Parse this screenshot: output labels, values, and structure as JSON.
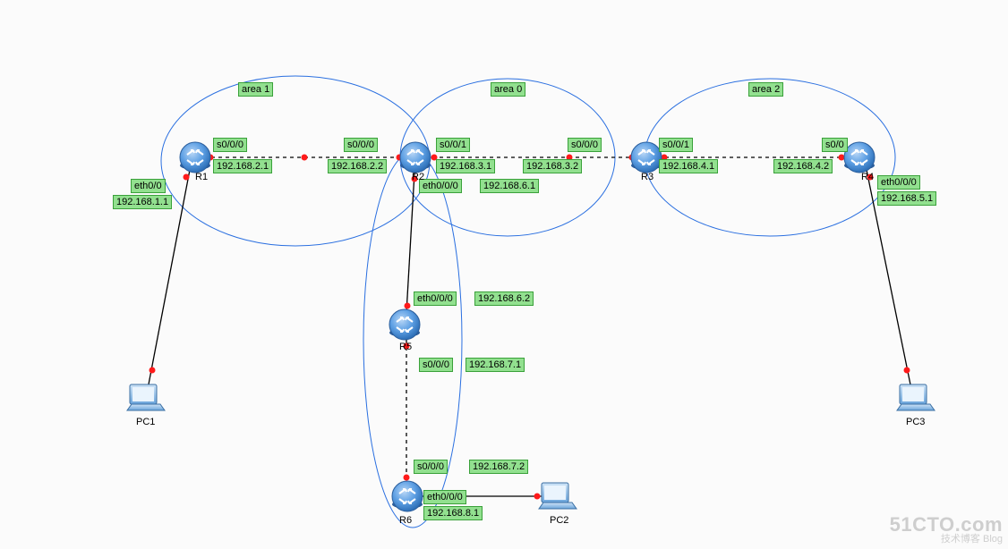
{
  "areas": {
    "a1": "area 1",
    "a0": "area 0",
    "a2": "area 2"
  },
  "nodes": {
    "r1": "R1",
    "r2": "R2",
    "r3": "R3",
    "r4": "R4",
    "r5": "R5",
    "r6": "R6",
    "pc1": "PC1",
    "pc2": "PC2",
    "pc3": "PC3"
  },
  "if": {
    "r1_s000": "s0/0/0",
    "r1_eth000": "eth0/0",
    "r2_s000": "s0/0/0",
    "r2_s001": "s0/0/1",
    "r2_eth000": "eth0/0/0",
    "r3_s000": "s0/0/0",
    "r3_s001": "s0/0/1",
    "r4_s000": "s0/0/1",
    "r4_s001": "s0/0",
    "r4_eth000": "eth0/0/0",
    "r5_eth000": "eth0/0/0",
    "r5_s000": "s0/0/0",
    "r6_s000": "s0/0/0",
    "r6_eth000": "eth0/0/0"
  },
  "ip": {
    "r1_r2_a": "192.168.2.1",
    "r1_r2_b": "192.168.2.2",
    "r2_r3_a": "192.168.3.1",
    "r2_r3_b": "192.168.3.2",
    "r3_r4_a": "192.168.4.1",
    "r3_r4_b": "192.168.4.2",
    "r1_pc1": "192.168.1.1",
    "r4_pc3": "192.168.5.1",
    "r2_r5_a": "192.168.6.1",
    "r2_r5_b": "192.168.6.2",
    "r5_r6_a": "192.168.7.1",
    "r5_r6_b": "192.168.7.2",
    "r6_pc2": "192.168.8.1"
  },
  "watermark": {
    "brand": "51CTO.com",
    "tag": "技术博客 Blog"
  }
}
